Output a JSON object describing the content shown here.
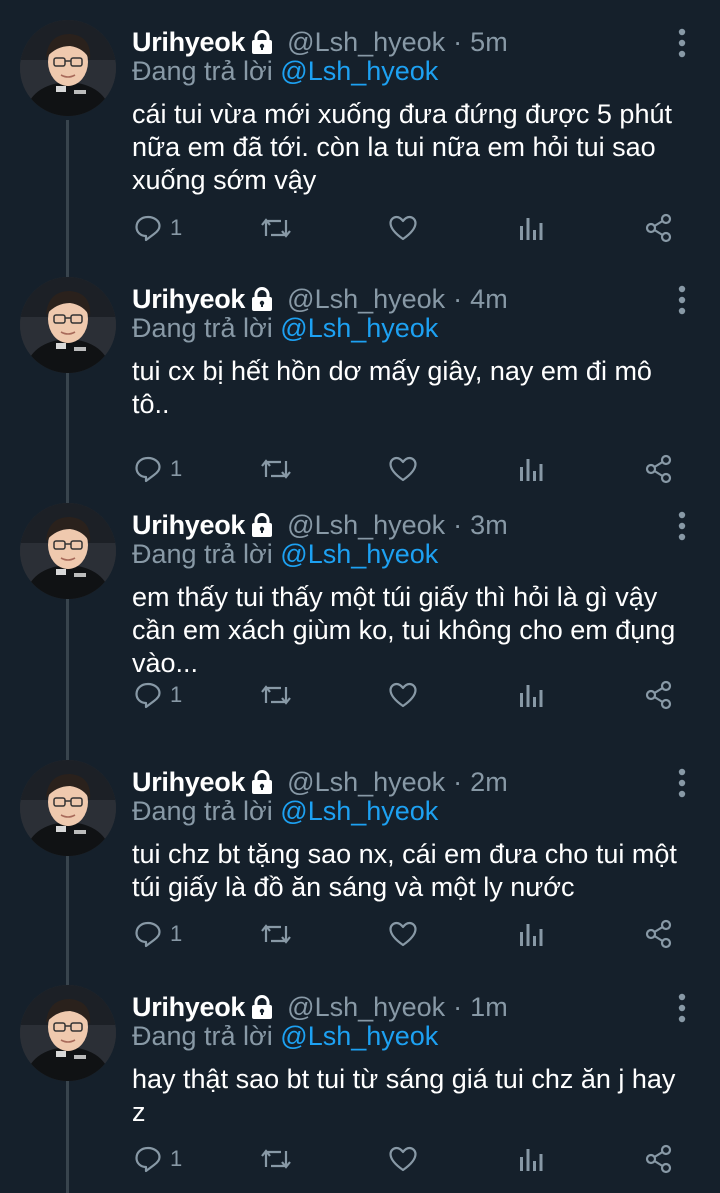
{
  "theme": {
    "background": "#15202b",
    "text": "#ffffff",
    "secondary": "#8899a6",
    "accent": "#1da1f2",
    "thread_line": "#38444d"
  },
  "tweets": [
    {
      "name": "Urihyeok",
      "handle": "@Lsh_hyeok",
      "separator": "·",
      "time": "5m",
      "reply_prefix": "Đang trả lời",
      "reply_to": "@Lsh_hyeok",
      "lines": [
        "cái tui vừa mới xuống đưa đứng được 5 phút",
        "nữa em đã tới. còn la tui nữa em hỏi tui sao",
        "xuống sớm vậy"
      ],
      "reply_count": "1",
      "icons": [
        "lock-icon",
        "more-vertical-icon",
        "reply-icon",
        "retweet-icon",
        "like-icon",
        "analytics-icon",
        "share-icon"
      ]
    },
    {
      "name": "Urihyeok",
      "handle": "@Lsh_hyeok",
      "separator": "·",
      "time": "4m",
      "reply_prefix": "Đang trả lời",
      "reply_to": "@Lsh_hyeok",
      "lines": [
        "tui cx bị hết hồn dơ mấy giây,  nay em đi mô",
        "tô.."
      ],
      "reply_count": "1"
    },
    {
      "name": "Urihyeok",
      "handle": "@Lsh_hyeok",
      "separator": "·",
      "time": "3m",
      "reply_prefix": "Đang trả lời",
      "reply_to": "@Lsh_hyeok",
      "lines": [
        "em thấy tui thấy một túi giấy thì hỏi là gì vậy",
        "cần em xách giùm ko, tui không cho em đụng",
        "vào..."
      ],
      "reply_count": "1"
    },
    {
      "name": "Urihyeok",
      "handle": "@Lsh_hyeok",
      "separator": "·",
      "time": "2m",
      "reply_prefix": "Đang trả lời",
      "reply_to": "@Lsh_hyeok",
      "lines": [
        "tui chz bt tặng sao nx, cái em đưa cho tui một",
        "túi giấy là đồ ăn sáng và một ly nước"
      ],
      "reply_count": "1"
    },
    {
      "name": "Urihyeok",
      "handle": "@Lsh_hyeok",
      "separator": "·",
      "time": "1m",
      "reply_prefix": "Đang trả lời",
      "reply_to": "@Lsh_hyeok",
      "lines": [
        "hay thật sao bt tui từ sáng giá tui chz ăn j hay",
        "z"
      ],
      "reply_count": "1"
    }
  ]
}
